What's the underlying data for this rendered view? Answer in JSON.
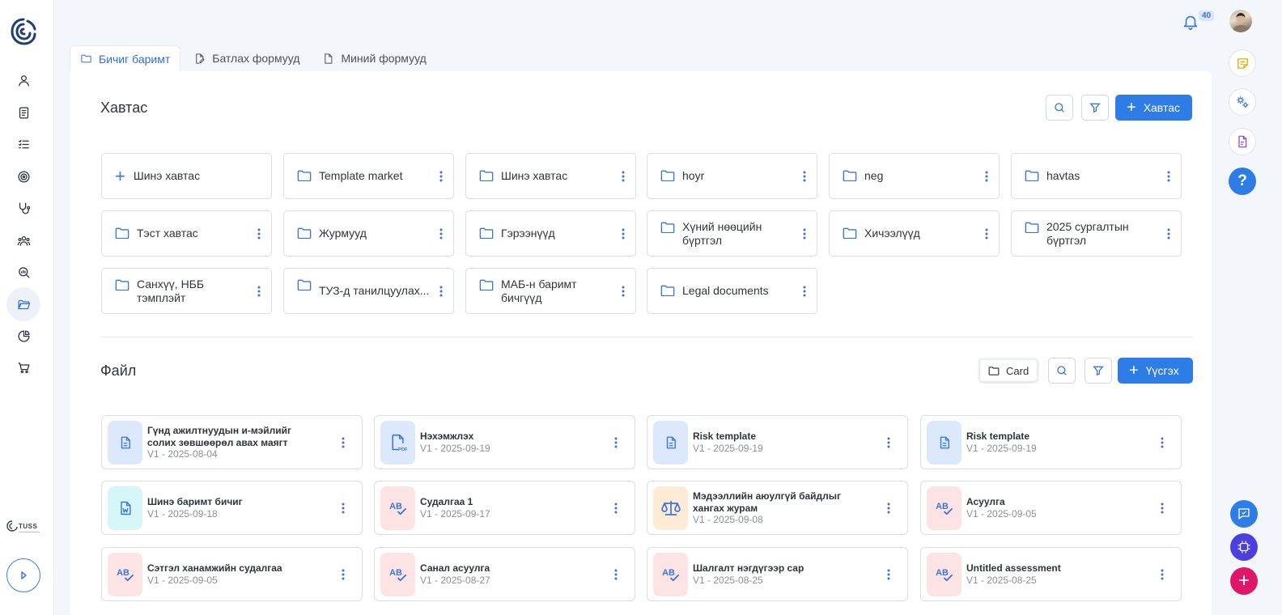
{
  "header": {
    "notification_count": "40"
  },
  "tabs": [
    {
      "label": "Бичиг баримт",
      "active": true
    },
    {
      "label": "Батлах формууд",
      "active": false
    },
    {
      "label": "Миний формууд",
      "active": false
    }
  ],
  "folders_section": {
    "title": "Хавтас",
    "add_label": "Хавтас",
    "new_folder_label": "Шинэ хавтас",
    "folders": [
      "Template market",
      "Шинэ хавтас",
      "hoyr",
      "neg",
      "havtas",
      "Тэст хавтас",
      "Журмууд",
      "Гэрээнүүд",
      "Хүний нөөцийн бүртгэл",
      "Хичээлүүд",
      "2025 сургалтын бүртгэл",
      "Санхүү, НББ тэмплэйт",
      "ТУЗ-д танилцуулах...",
      "МАБ-н баримт бичгүүд",
      "Legal documents"
    ]
  },
  "files_section": {
    "title": "Файл",
    "view_label": "Card",
    "add_label": "Үүсгэх",
    "files": [
      {
        "title": "Гүнд ажилтнуудын и-мэйлийг солих зөвшөөрөл авах маягт",
        "meta": "V1 - 2025-08-04",
        "icon": "document-icon"
      },
      {
        "title": "Нэхэмжлэх",
        "meta": "V1 - 2025-09-19",
        "icon": "pdf-icon"
      },
      {
        "title": "Risk template",
        "meta": "V1 - 2025-09-19",
        "icon": "document-icon"
      },
      {
        "title": "Risk template",
        "meta": "V1 - 2025-09-19",
        "icon": "document-icon"
      },
      {
        "title": "Шинэ баримт бичиг",
        "meta": "V1 - 2025-09-18",
        "icon": "word-icon"
      },
      {
        "title": "Судалгаа 1",
        "meta": "V1 - 2025-09-17",
        "icon": "survey-icon"
      },
      {
        "title": "Мэдээллийн аюулгүй байдлыг хангах журам",
        "meta": "V1 - 2025-09-08",
        "icon": "scale-icon"
      },
      {
        "title": "Асуулга",
        "meta": "V1 - 2025-09-05",
        "icon": "survey-icon"
      },
      {
        "title": "Сэтгэл ханамжийн судалгаа",
        "meta": "V1 - 2025-09-05",
        "icon": "survey-icon"
      },
      {
        "title": "Санал асуулга",
        "meta": "V1 - 2025-08-27",
        "icon": "survey-icon"
      },
      {
        "title": "Шалгалт нэгдүгээр сар",
        "meta": "V1 - 2025-08-25",
        "icon": "survey-icon"
      },
      {
        "title": "Untitled assessment",
        "meta": "V1 - 2025-08-25",
        "icon": "survey-icon"
      }
    ]
  },
  "brand": {
    "footer_logo_text": "TUSS"
  },
  "colors": {
    "accent": "#2e7ce6",
    "doc_tint": "#dce8fb",
    "survey_tint": "#fde3e3",
    "word_tint": "#d6f6f8",
    "scale_tint": "#fdebd6"
  }
}
